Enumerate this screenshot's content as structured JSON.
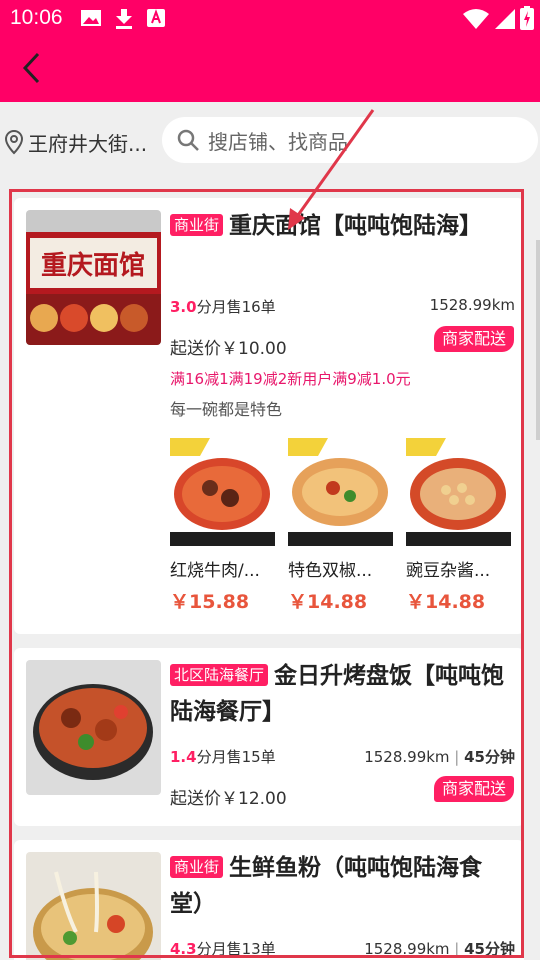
{
  "status": {
    "time": "10:06"
  },
  "search": {
    "location": "王府井大街...",
    "placeholder": "搜店铺、找商品"
  },
  "shops": [
    {
      "tag": "商业街",
      "name": "重庆面馆【吨吨饱陆海】",
      "score": "3.0",
      "score_unit": "分",
      "sales": "月售16单",
      "distance": "1528.99km",
      "time": "",
      "min_order": "起送价￥10.00",
      "delivery": "商家配送",
      "promo": "满16减1满19减2新用户满9减1.0元",
      "slogan": "每一碗都是特色",
      "dishes": [
        {
          "name": "红烧牛肉/...",
          "price": "￥15.88"
        },
        {
          "name": "特色双椒...",
          "price": "￥14.88"
        },
        {
          "name": "豌豆杂酱...",
          "price": "￥14.88"
        }
      ]
    },
    {
      "tag": "北区陆海餐厅",
      "name": "金日升烤盘饭【吨吨饱陆海餐厅】",
      "score": "1.4",
      "score_unit": "分",
      "sales": "月售15单",
      "distance": "1528.99km",
      "time": "45分钟",
      "min_order": "起送价￥12.00",
      "delivery": "商家配送"
    },
    {
      "tag": "商业街",
      "name": "生鲜鱼粉（吨吨饱陆海食堂）",
      "score": "4.3",
      "score_unit": "分",
      "sales": "月售13单",
      "distance": "1528.99km",
      "time": "45分钟"
    }
  ],
  "colors": {
    "brand": "#ff0066",
    "price": "#e8553c",
    "annotation": "#e0374a"
  }
}
